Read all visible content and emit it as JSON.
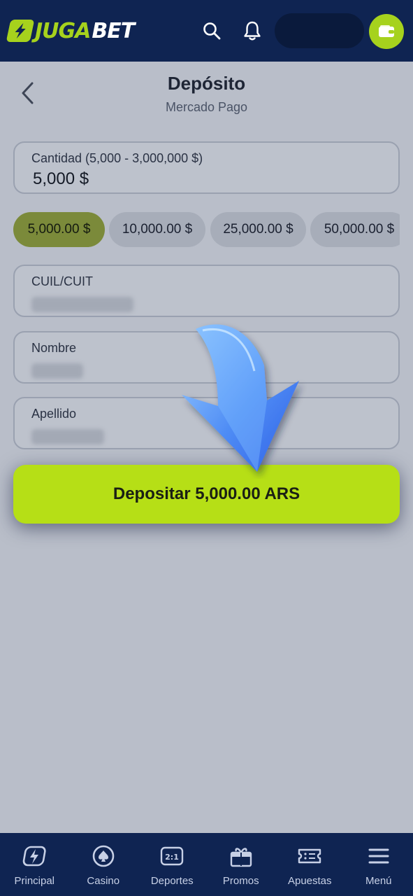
{
  "header": {
    "brand_left": "JUGA",
    "brand_right": "BET",
    "icons": [
      "search-icon",
      "bell-icon",
      "wallet-icon"
    ],
    "colors": {
      "background": "#0f2452",
      "accent": "#a6d21d"
    }
  },
  "page": {
    "title": "Depósito",
    "subtitle": "Mercado Pago"
  },
  "amount_field": {
    "label": "Cantidad (5,000 - 3,000,000 $)",
    "value": "5,000 $"
  },
  "quick_amounts": [
    {
      "label": "5,000.00 $",
      "selected": true
    },
    {
      "label": "10,000.00 $",
      "selected": false
    },
    {
      "label": "25,000.00 $",
      "selected": false
    },
    {
      "label": "50,000.00 $",
      "selected": false
    }
  ],
  "fields": [
    {
      "label": "CUIL/CUIT"
    },
    {
      "label": "Nombre"
    },
    {
      "label": "Apellido"
    }
  ],
  "cta": {
    "label": "Depositar 5,000.00 ARS",
    "color": "#b6df16"
  },
  "bottom_nav": [
    {
      "label": "Principal",
      "icon": "lightning-icon"
    },
    {
      "label": "Casino",
      "icon": "spade-chip-icon"
    },
    {
      "label": "Deportes",
      "icon": "odds-2-1-icon"
    },
    {
      "label": "Promos",
      "icon": "gift-icon"
    },
    {
      "label": "Apuestas",
      "icon": "ticket-icon"
    },
    {
      "label": "Menú",
      "icon": "hamburger-icon"
    }
  ],
  "odds_icon_text": "2:1"
}
